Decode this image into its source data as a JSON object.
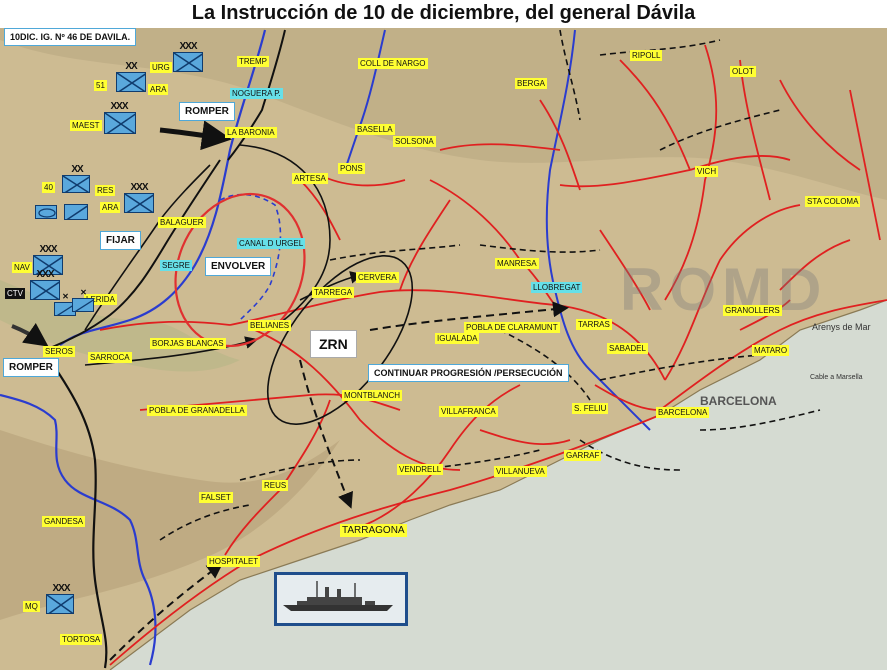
{
  "title": "La Instrucción de 10 de diciembre, del general Dávila",
  "header_box": "10DIC. IG. Nº 46 DE DAVILA.",
  "colors": {
    "land": "#cdbb92",
    "sea": "#d5dbd2",
    "rail": "#e02020",
    "river": "#2a3ccf",
    "front": "#111111",
    "label_bg": "#ffff33",
    "canal_label_bg": "#66e0e8",
    "unit_fill": "#5aa8dc",
    "unit_border": "#103c6e",
    "envelop_ellipse": "#e03030",
    "ship_frame": "#1f4e8c"
  },
  "action_labels": {
    "romper_north": "ROMPER",
    "romper_south": "ROMPER",
    "fijar": "FIJAR",
    "envolver": "ENVOLVER",
    "zrn": "ZRN",
    "continuar": "CONTINUAR PROGRESIÓN /PERSECUCIÓN"
  },
  "units": [
    {
      "id": "URG",
      "label": "URG",
      "echelon": "XXX",
      "symbol": "infantry"
    },
    {
      "id": "51",
      "label": "51",
      "echelon": "XX",
      "symbol": "infantry"
    },
    {
      "id": "ARA1",
      "label": "ARA",
      "echelon": "",
      "symbol": "infantry"
    },
    {
      "id": "MAEST",
      "label": "MAEST",
      "echelon": "XXX",
      "symbol": "infantry"
    },
    {
      "id": "40",
      "label": "40",
      "echelon": "XX",
      "symbol": "infantry"
    },
    {
      "id": "RES",
      "label": "RES",
      "echelon": "",
      "symbol": "reserve"
    },
    {
      "id": "ARA2",
      "label": "ARA",
      "echelon": "XXX",
      "symbol": "infantry"
    },
    {
      "id": "NAV",
      "label": "NAV",
      "echelon": "XXX",
      "symbol": "infantry"
    },
    {
      "id": "CTV",
      "label": "CTV",
      "echelon": "XXX",
      "symbol": "infantry"
    },
    {
      "id": "MQ",
      "label": "MQ",
      "echelon": "XXX",
      "symbol": "infantry"
    }
  ],
  "places": [
    {
      "name": "TREMP"
    },
    {
      "name": "COLL DE NARGO"
    },
    {
      "name": "RIPOLL"
    },
    {
      "name": "OLOT"
    },
    {
      "name": "BERGA"
    },
    {
      "name": "NOGUERA P."
    },
    {
      "name": "LA BARONIA"
    },
    {
      "name": "BASELLA"
    },
    {
      "name": "SOLSONA"
    },
    {
      "name": "ARTESA"
    },
    {
      "name": "PONS"
    },
    {
      "name": "VICH"
    },
    {
      "name": "STA COLOMA"
    },
    {
      "name": "BALAGUER"
    },
    {
      "name": "CANAL D URGEL"
    },
    {
      "name": "SEGRE"
    },
    {
      "name": "MANRESA"
    },
    {
      "name": "CERVERA"
    },
    {
      "name": "LLOBREGAT"
    },
    {
      "name": "LERIDA"
    },
    {
      "name": "TARREGA"
    },
    {
      "name": "GRANOLLERS"
    },
    {
      "name": "BELIANES"
    },
    {
      "name": "POBLA DE CLARAMUNT"
    },
    {
      "name": "TARRAS"
    },
    {
      "name": "SEROS"
    },
    {
      "name": "BORJAS BLANCAS"
    },
    {
      "name": "IGUALADA"
    },
    {
      "name": "SABADEL"
    },
    {
      "name": "MATARO"
    },
    {
      "name": "SARROCA"
    },
    {
      "name": "MONTBLANCH"
    },
    {
      "name": "POBLA DE GRANADELLA"
    },
    {
      "name": "VILLAFRANCA"
    },
    {
      "name": "S. FELIU"
    },
    {
      "name": "BARCELONA"
    },
    {
      "name": "VENDRELL"
    },
    {
      "name": "VILLANUEVA"
    },
    {
      "name": "GARRAF"
    },
    {
      "name": "FALSET"
    },
    {
      "name": "REUS"
    },
    {
      "name": "TARRAGONA"
    },
    {
      "name": "GANDESA"
    },
    {
      "name": "HOSPITALET"
    },
    {
      "name": "TORTOSA"
    }
  ],
  "basemap_labels": {
    "sea_city": "BARCELONA",
    "coast_note": "Cable a Marsella",
    "arenys": "Arenys de Mar"
  }
}
